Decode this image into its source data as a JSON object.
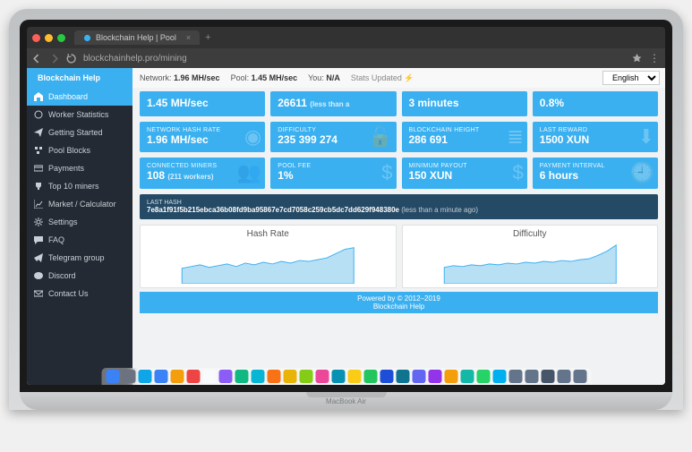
{
  "browser": {
    "tab_title": "Blockchain Help | Pool",
    "url": "blockchainhelp.pro/mining"
  },
  "header": {
    "brand": "Blockchain Help",
    "network_label": "Network:",
    "network_value": "1.96 MH/sec",
    "pool_label": "Pool:",
    "pool_value": "1.45 MH/sec",
    "you_label": "You:",
    "you_value": "N/A",
    "stats_updated": "Stats Updated",
    "language": "English"
  },
  "sidebar": {
    "items": [
      {
        "label": "Dashboard",
        "icon": "home"
      },
      {
        "label": "Worker Statistics",
        "icon": "gauge"
      },
      {
        "label": "Getting Started",
        "icon": "plane"
      },
      {
        "label": "Pool Blocks",
        "icon": "cubes"
      },
      {
        "label": "Payments",
        "icon": "card"
      },
      {
        "label": "Top 10 miners",
        "icon": "trophy"
      },
      {
        "label": "Market / Calculator",
        "icon": "chart"
      },
      {
        "label": "Settings",
        "icon": "gear"
      },
      {
        "label": "FAQ",
        "icon": "chat"
      },
      {
        "label": "Telegram group",
        "icon": "telegram"
      },
      {
        "label": "Discord",
        "icon": "discord"
      },
      {
        "label": "Contact Us",
        "icon": "mail"
      }
    ]
  },
  "tiles": {
    "row0": [
      {
        "value": "1.45 MH/sec"
      },
      {
        "value": "26611",
        "sub": "(less than a"
      },
      {
        "value": "3 minutes"
      },
      {
        "value": "0.8%"
      }
    ],
    "row1": [
      {
        "label": "NETWORK HASH RATE",
        "value": "1.96 MH/sec",
        "icon": "◉"
      },
      {
        "label": "DIFFICULTY",
        "value": "235 399 274",
        "icon": "🔓"
      },
      {
        "label": "BLOCKCHAIN HEIGHT",
        "value": "286 691",
        "icon": "≣"
      },
      {
        "label": "LAST REWARD",
        "value": "1500 XUN",
        "icon": "⬇"
      }
    ],
    "row2": [
      {
        "label": "CONNECTED MINERS",
        "value": "108",
        "sub": "(211 workers)",
        "icon": "👥"
      },
      {
        "label": "POOL FEE",
        "value": "1%",
        "icon": "$"
      },
      {
        "label": "MINIMUM PAYOUT",
        "value": "150 XUN",
        "icon": "$"
      },
      {
        "label": "PAYMENT INTERVAL",
        "value": "6 hours",
        "icon": "🕘"
      }
    ]
  },
  "last_hash": {
    "label": "LAST HASH",
    "value": "7e8a1f91f5b215ebca36b08fd9ba95867e7cd7058c259cb5dc7dd629f948380e",
    "ago": "(less than a minute ago)"
  },
  "charts": {
    "hashrate_title": "Hash Rate",
    "difficulty_title": "Difficulty"
  },
  "footer": {
    "line1": "Powered by © 2012–2019",
    "line2": "Blockchain Help"
  },
  "laptop_model": "MacBook Air",
  "chart_data": [
    {
      "type": "area",
      "title": "Hash Rate",
      "x": [
        0,
        1,
        2,
        3,
        4,
        5,
        6,
        7,
        8,
        9,
        10,
        11,
        12,
        13,
        14,
        15,
        16,
        17,
        18,
        19
      ],
      "values": [
        18,
        20,
        22,
        19,
        21,
        23,
        20,
        24,
        22,
        25,
        23,
        26,
        24,
        27,
        26,
        28,
        30,
        35,
        40,
        42
      ],
      "ylim": [
        0,
        50
      ]
    },
    {
      "type": "area",
      "title": "Difficulty",
      "x": [
        0,
        1,
        2,
        3,
        4,
        5,
        6,
        7,
        8,
        9,
        10,
        11,
        12,
        13,
        14,
        15,
        16,
        17,
        18,
        19
      ],
      "values": [
        19,
        21,
        20,
        22,
        21,
        23,
        22,
        24,
        23,
        25,
        24,
        26,
        25,
        27,
        26,
        28,
        29,
        33,
        38,
        45
      ],
      "ylim": [
        0,
        50
      ]
    }
  ]
}
